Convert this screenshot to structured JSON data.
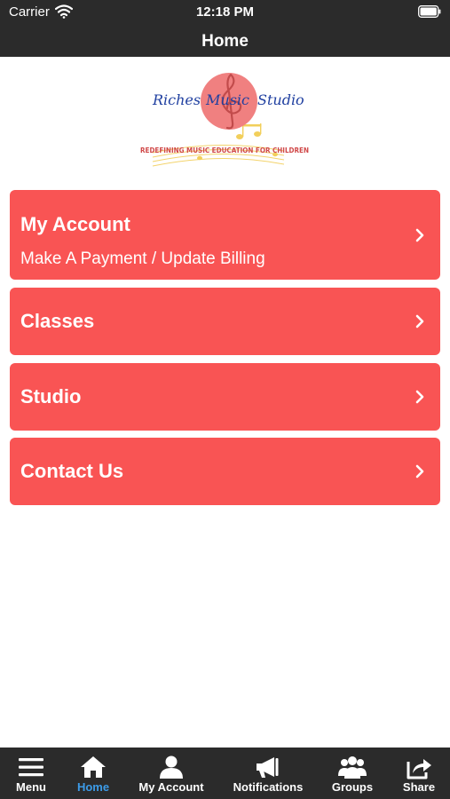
{
  "status": {
    "carrier": "Carrier",
    "time": "12:18 PM"
  },
  "nav": {
    "title": "Home"
  },
  "logo": {
    "word1": "Riches",
    "word2": "Music",
    "word3": "Studio",
    "tagline": "REDEFINING MUSIC EDUCATION FOR CHILDREN"
  },
  "menu": {
    "my_account": {
      "label": "My Account",
      "sublabel": "Make A Payment / Update Billing"
    },
    "classes": {
      "label": "Classes"
    },
    "studio": {
      "label": "Studio"
    },
    "contact_us": {
      "label": "Contact Us"
    }
  },
  "tabs": {
    "menu": "Menu",
    "home": "Home",
    "my_account": "My Account",
    "notifications": "Notifications",
    "groups": "Groups",
    "share": "Share"
  },
  "colors": {
    "accent": "#f95454",
    "bar": "#2b2b2b",
    "active_tab": "#3c9be8"
  }
}
